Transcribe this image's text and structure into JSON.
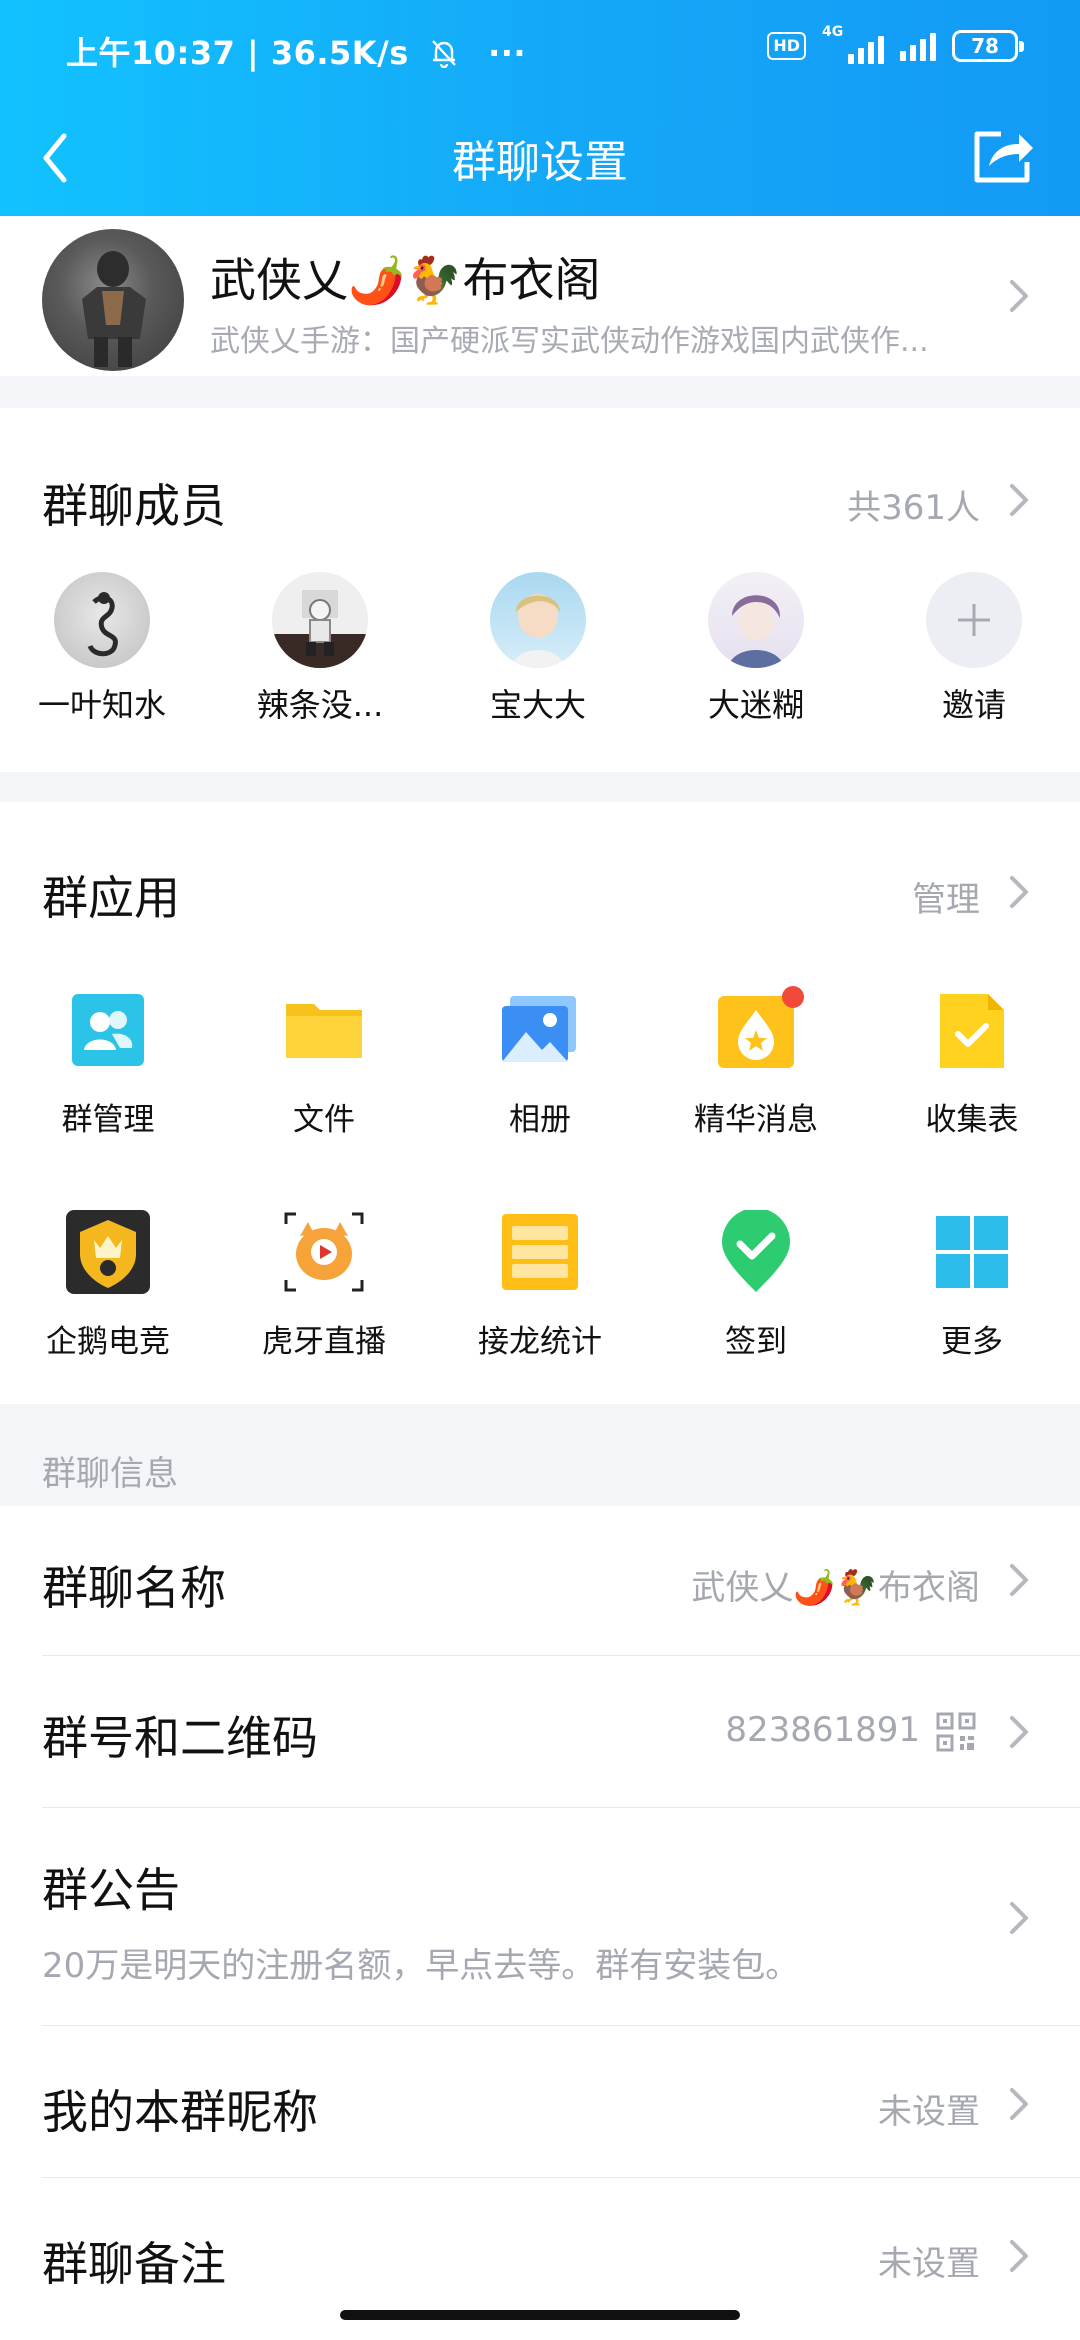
{
  "status_bar": {
    "time_speed": "上午10:37 | 36.5K/s",
    "more": "···",
    "hd": "HD",
    "net": "4G",
    "battery": "78"
  },
  "nav": {
    "title": "群聊设置"
  },
  "group": {
    "name": "武侠乂🌶️🐓布衣阁",
    "description": "武侠乂手游：国产硬派写实武侠动作游戏国内武侠作..."
  },
  "members": {
    "title": "群聊成员",
    "count": "共361人",
    "items": [
      {
        "name": "一叶知水"
      },
      {
        "name": "辣条没..."
      },
      {
        "name": "宝大大"
      },
      {
        "name": "大迷糊"
      },
      {
        "name": "邀请"
      }
    ]
  },
  "apps": {
    "title": "群应用",
    "manage": "管理",
    "items": [
      {
        "label": "群管理",
        "icon": "group-manage-icon"
      },
      {
        "label": "文件",
        "icon": "folder-icon"
      },
      {
        "label": "相册",
        "icon": "album-icon"
      },
      {
        "label": "精华消息",
        "icon": "essence-icon"
      },
      {
        "label": "收集表",
        "icon": "form-icon"
      },
      {
        "label": "企鹅电竞",
        "icon": "esports-icon"
      },
      {
        "label": "虎牙直播",
        "icon": "huya-icon"
      },
      {
        "label": "接龙统计",
        "icon": "relay-icon"
      },
      {
        "label": "签到",
        "icon": "checkin-icon"
      },
      {
        "label": "更多",
        "icon": "more-grid-icon"
      }
    ]
  },
  "info": {
    "section_label": "群聊信息",
    "rows": [
      {
        "title": "群聊名称",
        "value": "武侠乂🌶️🐓布衣阁"
      },
      {
        "title": "群号和二维码",
        "value": "823861891"
      },
      {
        "title": "群公告",
        "value": "20万是明天的注册名额，早点去等。群有安装包。"
      },
      {
        "title": "我的本群昵称",
        "value": "未设置"
      },
      {
        "title": "群聊备注",
        "value": "未设置"
      }
    ]
  },
  "colors": {
    "header_start": "#12c2ff",
    "header_end": "#139af5",
    "secondary_text": "#a5a8b0",
    "badge_red": "#f24a3a"
  }
}
